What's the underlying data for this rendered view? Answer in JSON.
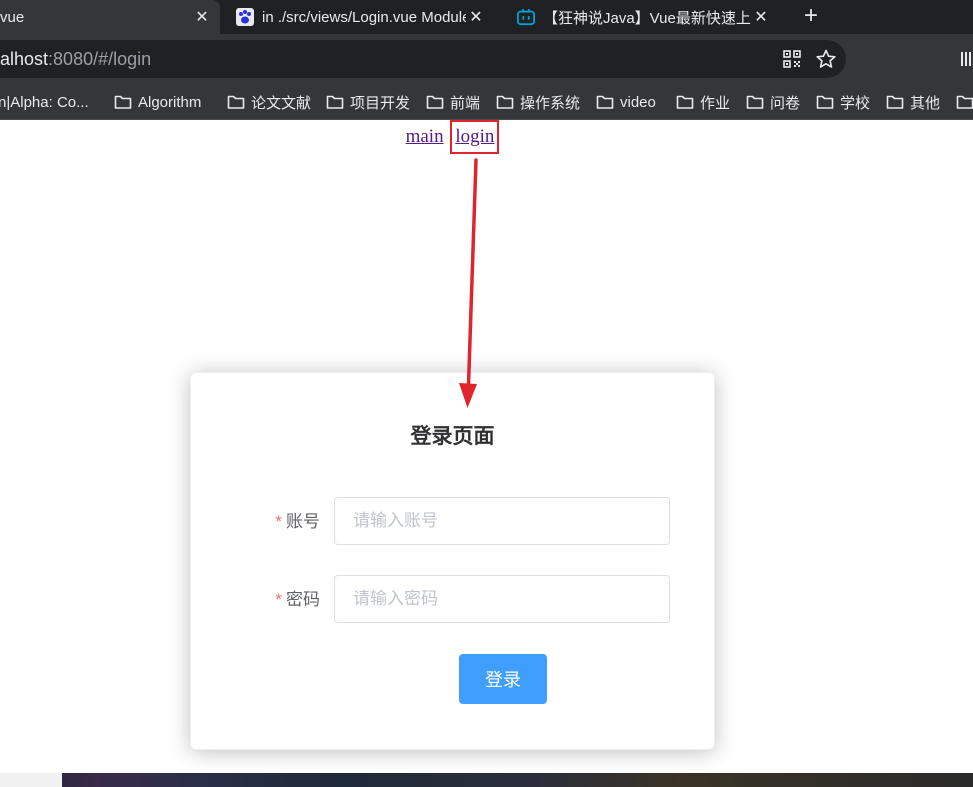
{
  "browser": {
    "tabs": [
      {
        "title": "vue",
        "active": true
      },
      {
        "title": "in ./src/views/Login.vue Module",
        "active": false
      },
      {
        "title": "【狂神说Java】Vue最新快速上手",
        "active": false
      }
    ],
    "url": {
      "host": "alhost",
      "path": ":8080/#/login"
    },
    "bookmarks": [
      {
        "label": "n|Alpha: Co...",
        "folder": false
      },
      {
        "label": "Algorithm",
        "folder": true
      },
      {
        "label": "论文文献",
        "folder": true
      },
      {
        "label": "项目开发",
        "folder": true
      },
      {
        "label": "前端",
        "folder": true
      },
      {
        "label": "操作系统",
        "folder": true
      },
      {
        "label": "video",
        "folder": true
      },
      {
        "label": "作业",
        "folder": true
      },
      {
        "label": "问卷",
        "folder": true
      },
      {
        "label": "学校",
        "folder": true
      },
      {
        "label": "其他",
        "folder": true
      }
    ]
  },
  "page": {
    "nav": {
      "main": "main",
      "login": "login"
    },
    "card": {
      "title": "登录页面",
      "account": {
        "required": "*",
        "label": "账号",
        "placeholder": "请输入账号",
        "value": ""
      },
      "password": {
        "required": "*",
        "label": "密码",
        "placeholder": "请输入密码",
        "value": ""
      },
      "submit": "登录"
    }
  },
  "colors": {
    "primary": "#409eff",
    "required": "#f56c6c",
    "annotation": "#e0242c",
    "link": "#551a8b"
  }
}
